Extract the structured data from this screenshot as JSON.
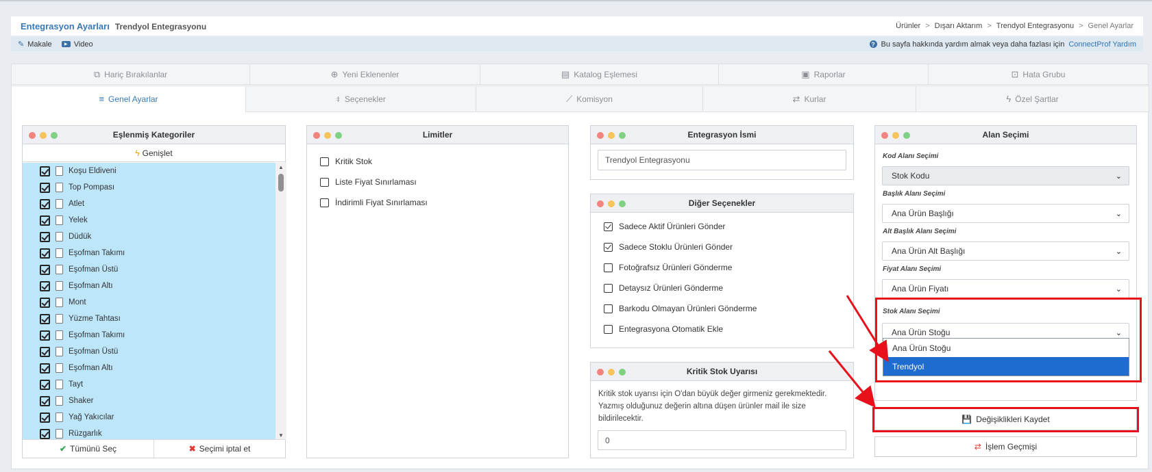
{
  "header": {
    "title": "Entegrasyon Ayarları",
    "subtitle": "Trendyol Entegrasyonu",
    "breadcrumb": [
      "Ürünler",
      "Dışarı Aktarım",
      "Trendyol Entegrasyonu",
      "Genel Ayarlar"
    ]
  },
  "subbar": {
    "links": [
      {
        "icon": "pencil-icon",
        "label": "Makale"
      },
      {
        "icon": "youtube-icon",
        "label": "Video"
      }
    ],
    "help_text": "Bu sayfa hakkında yardım almak veya daha fazlası için",
    "help_link": "ConnectProf Yardım"
  },
  "tabs_row1": [
    {
      "label": "Hariç Bırakılanlar",
      "icon": "copy-off-icon"
    },
    {
      "label": "Yeni Eklenenler",
      "icon": "add-copy-icon"
    },
    {
      "label": "Katalog Eşlemesi",
      "icon": "catalog-icon"
    },
    {
      "label": "Raporlar",
      "icon": "report-icon"
    },
    {
      "label": "Hata Grubu",
      "icon": "error-group-icon"
    }
  ],
  "tabs_row2": [
    {
      "label": "Genel Ayarlar",
      "icon": "filter-lines-icon",
      "active": true
    },
    {
      "label": "Seçenekler",
      "icon": "sliders-icon"
    },
    {
      "label": "Komisyon",
      "icon": "chart-line-icon"
    },
    {
      "label": "Kurlar",
      "icon": "exchange-icon"
    },
    {
      "label": "Özel Şartlar",
      "icon": "bolt-icon"
    }
  ],
  "categories_panel": {
    "title": "Eşlenmiş Kategoriler",
    "expand": "Genişlet",
    "items": [
      "Koşu Eldiveni",
      "Top Pompası",
      "Atlet",
      "Yelek",
      "Düdük",
      "Eşofman Takımı",
      "Eşofman Üstü",
      "Eşofman Altı",
      "Mont",
      "Yüzme Tahtası",
      "Eşofman Takımı",
      "Eşofman Üstü",
      "Eşofman Altı",
      "Tayt",
      "Shaker",
      "Yağ Yakıcılar",
      "Rüzgarlık"
    ],
    "select_all": "Tümünü Seç",
    "cancel_select": "Seçimi iptal et"
  },
  "limits_panel": {
    "title": "Limitler",
    "options": [
      {
        "label": "Kritik Stok",
        "checked": false
      },
      {
        "label": "Liste Fiyat Sınırlaması",
        "checked": false
      },
      {
        "label": "İndirimli Fiyat Sınırlaması",
        "checked": false
      }
    ]
  },
  "name_panel": {
    "title": "Entegrasyon İsmi",
    "value": "Trendyol  Entegrasyonu"
  },
  "other_panel": {
    "title": "Diğer Seçenekler",
    "options": [
      {
        "label": "Sadece Aktif Ürünleri Gönder",
        "checked": true
      },
      {
        "label": "Sadece Stoklu Ürünleri Gönder",
        "checked": true
      },
      {
        "label": "Fotoğrafsız Ürünleri Gönderme",
        "checked": false
      },
      {
        "label": "Detaysız Ürünleri Gönderme",
        "checked": false
      },
      {
        "label": "Barkodu Olmayan Ürünleri Gönderme",
        "checked": false
      },
      {
        "label": "Entegrasyona Otomatik Ekle",
        "checked": false
      }
    ]
  },
  "kritik_panel": {
    "title": "Kritik Stok Uyarısı",
    "text": "Kritik stok uyarısı için O'dan büyük değer girmeniz gerekmektedir. Yazmış olduğunuz değerin altına düşen ürünler mail ile size bildirilecektir.",
    "value": "0"
  },
  "field_panel": {
    "title": "Alan Seçimi",
    "fields": [
      {
        "label": "Kod Alanı Seçimi",
        "value": "Stok Kodu",
        "disabled": true
      },
      {
        "label": "Başlık Alanı Seçimi",
        "value": "Ana Ürün Başlığı"
      },
      {
        "label": "Alt Başlık Alanı Seçimi",
        "value": "Ana Ürün Alt Başlığı"
      },
      {
        "label": "Fiyat Alanı Seçimi",
        "value": "Ana Ürün Fiyatı"
      },
      {
        "label": "Stok Alanı Seçimi",
        "value": "Ana Ürün Stoğu"
      }
    ],
    "dropdown_options": [
      "Ana Ürün Stoğu",
      "Trendyol"
    ],
    "dropdown_selected": "Trendyol"
  },
  "actions": {
    "save": "Değişiklikleri Kaydet",
    "history": "İşlem Geçmişi"
  },
  "colors": {
    "accent": "#3a78b5",
    "highlight": "#bde6fb",
    "annotation": "#e8101a",
    "selected_option": "#1e6ccf"
  }
}
